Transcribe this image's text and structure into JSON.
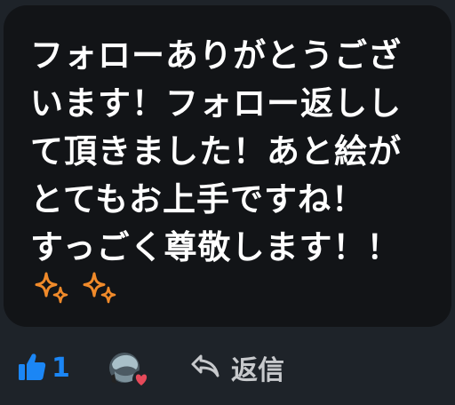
{
  "comment": {
    "lines": [
      "フォローありがとうござ",
      "います！フォロー返しし",
      "て頂きました！あと絵が",
      "とてもお上手ですね！",
      "すっごく尊敬します！！"
    ],
    "emoji": [
      "sparkles-icon",
      "sparkles-icon"
    ]
  },
  "actions": {
    "like_icon": "thumbs-up-icon",
    "like_count": "1",
    "creator_heart": "creator-heart-icon",
    "reply_icon": "reply-arrow-icon",
    "reply_label": "返信"
  },
  "colors": {
    "background": "#1e2329",
    "bubble": "#121417",
    "text": "#ffffff",
    "like": "#1b86f5",
    "sparkle": "#f08a2a",
    "heart": "#e64a5a",
    "reply": "#c7c9cc"
  }
}
